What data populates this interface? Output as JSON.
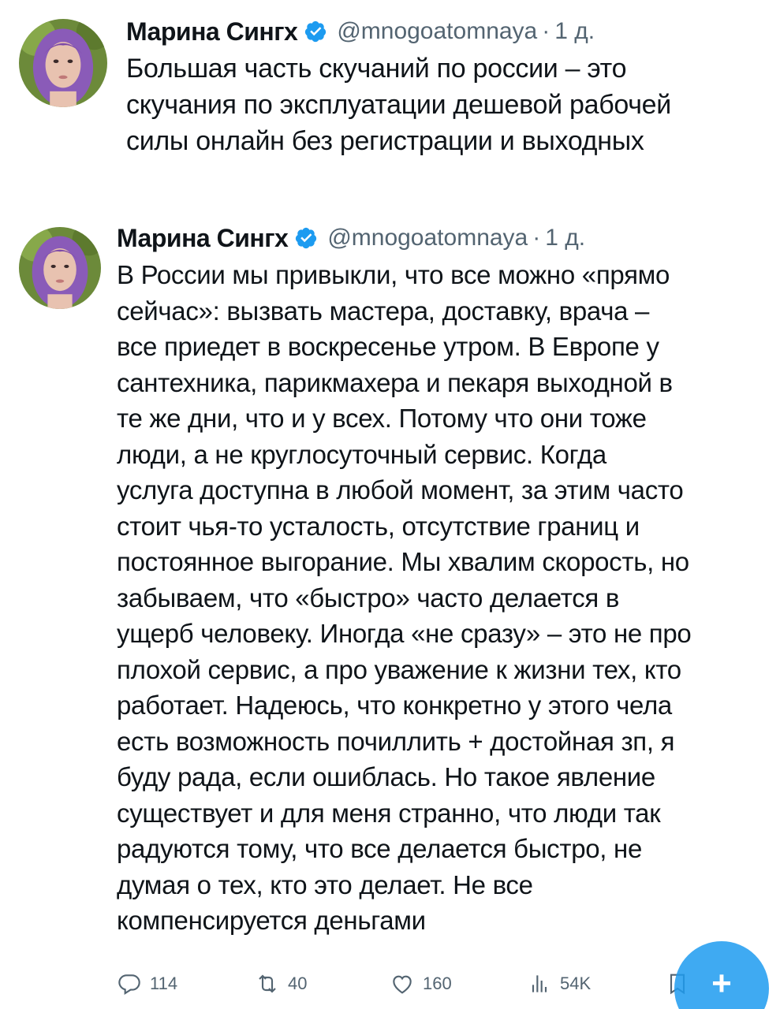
{
  "tweets": [
    {
      "author_name": "Марина Сингх",
      "handle": "@mnogoatomnaya",
      "separator": "·",
      "time": "1 д.",
      "text": "Большая часть скучаний по россии – это\nскучания по эксплуатации дешевой рабочей\nсилы онлайн без регистрации и выходных"
    },
    {
      "author_name": "Марина Сингх",
      "handle": "@mnogoatomnaya",
      "separator": "·",
      "time": "1 д.",
      "text": "В России мы привыкли, что все можно «прямо\nсейчас»: вызвать мастера, доставку, врача –\nвсе приедет в воскресенье утром. В Европе у\nсантехника, парикмахера и пекаря выходной в\nте же дни, что и у всех. Потому что они тоже\nлюди, а не круглосуточный сервис. Когда\nуслуга доступна в любой момент, за этим часто\nстоит чья-то усталость, отсутствие границ и\nпостоянное выгорание. Мы хвалим скорость, но\nзабываем, что «быстро» часто делается в\nущерб человеку. Иногда «не сразу» – это не про\nплохой сервис, а про уважение к жизни тех, кто\nработает. Надеюсь, что конкретно у этого чела\nесть возможность почиллить + достойная зп, я\nбуду рада, если ошиблась. Но такое явление\nсуществует и для меня странно, что люди так\nрадуются тому, что все делается быстро, не\nдумая о тех, кто это делает. Не все\nкомпенсируется деньгами"
    }
  ],
  "actions": {
    "replies": "114",
    "retweets": "40",
    "likes": "160",
    "views": "54K"
  },
  "fab": {
    "label": "+"
  },
  "icons": {
    "verified": "verified-badge-icon",
    "reply": "reply-icon",
    "retweet": "retweet-icon",
    "like": "heart-icon",
    "views": "views-icon",
    "bookmark": "bookmark-icon",
    "compose": "compose-plus-icon"
  },
  "colors": {
    "accent": "#1d9bf0",
    "text": "#0f1419",
    "muted": "#536471",
    "background": "#ffffff"
  }
}
